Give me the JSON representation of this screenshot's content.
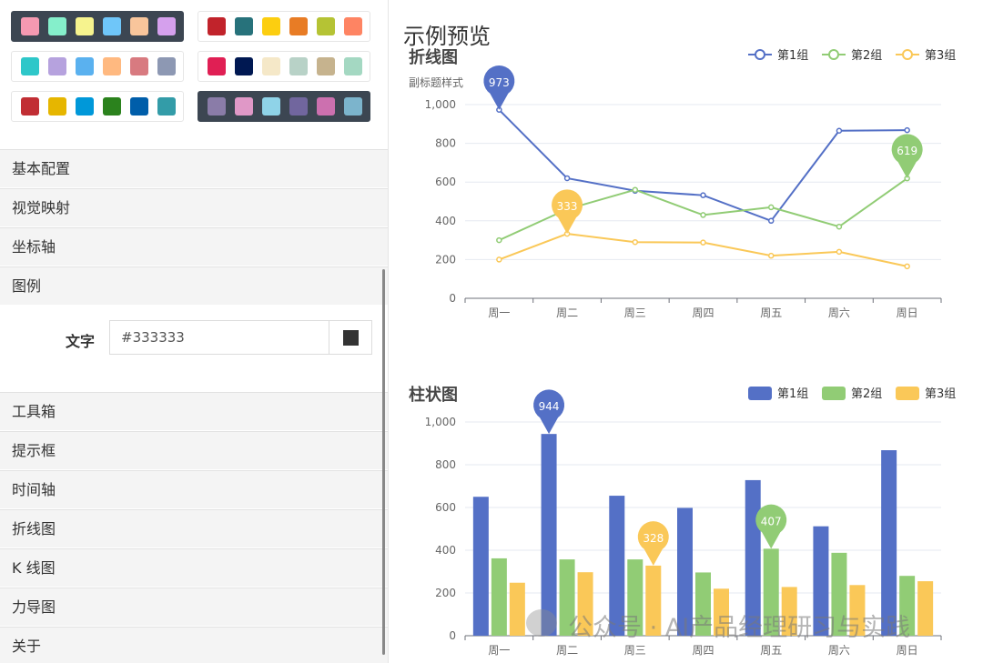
{
  "sidebar": {
    "themes": [
      {
        "colors": [
          "#f599b1",
          "#85efcb",
          "#f6f38e",
          "#6fc6f9",
          "#f8c59b",
          "#d5a0ed"
        ],
        "selected": true
      },
      {
        "colors": [
          "#c1232b",
          "#27727b",
          "#fcce10",
          "#e87c25",
          "#b5c334",
          "#fe8463"
        ],
        "selected": false
      },
      {
        "colors": [
          "#2ec7c9",
          "#b6a2de",
          "#5ab1ef",
          "#ffb980",
          "#d87a80",
          "#8d98b3"
        ],
        "selected": false
      },
      {
        "colors": [
          "#e01f54",
          "#001852",
          "#f5e8c8",
          "#b8d2c7",
          "#c6b38e",
          "#a4d8c2"
        ],
        "selected": false
      },
      {
        "colors": [
          "#c12e34",
          "#e6b600",
          "#0098d9",
          "#2b821d",
          "#005eaa",
          "#339ca8"
        ],
        "selected": false
      },
      {
        "colors": [
          "#8a7ca8",
          "#e098c7",
          "#8fd3e8",
          "#71669e",
          "#cc70af",
          "#7cb4cc"
        ],
        "selected": true
      }
    ],
    "menu": [
      "基本配置",
      "视觉映射",
      "坐标轴",
      "图例",
      "工具箱",
      "提示框",
      "时间轴",
      "折线图",
      "K 线图",
      "力导图",
      "关于"
    ],
    "legend_field": {
      "label": "文字",
      "value": "#333333",
      "swatch_color": "#333333"
    }
  },
  "preview": {
    "title": "示例预览",
    "watermark": "公众号 · AI产品经理研习与实践"
  },
  "colors": {
    "series1": "#5470c6",
    "series2": "#91cc75",
    "series3": "#fac858",
    "selected_theme_bg": "#3c4652"
  },
  "chart_data": [
    {
      "type": "line",
      "title": "折线图",
      "subtitle": "副标题样式",
      "categories": [
        "周一",
        "周二",
        "周三",
        "周四",
        "周五",
        "周六",
        "周日"
      ],
      "series": [
        {
          "name": "第1组",
          "values": [
            973,
            620,
            555,
            532,
            400,
            865,
            868
          ]
        },
        {
          "name": "第2组",
          "values": [
            300,
            460,
            560,
            430,
            470,
            370,
            619
          ]
        },
        {
          "name": "第3组",
          "values": [
            200,
            333,
            290,
            288,
            220,
            240,
            165
          ]
        }
      ],
      "markers": [
        {
          "series": 0,
          "index": 0,
          "label": "973"
        },
        {
          "series": 2,
          "index": 1,
          "label": "333"
        },
        {
          "series": 1,
          "index": 6,
          "label": "619"
        }
      ],
      "ylim": [
        0,
        1000
      ],
      "yticks": [
        "0",
        "200",
        "400",
        "600",
        "800",
        "1,000"
      ],
      "legend": "top-right",
      "grid": true
    },
    {
      "type": "bar",
      "title": "柱状图",
      "categories": [
        "周一",
        "周二",
        "周三",
        "周四",
        "周五",
        "周六",
        "周日"
      ],
      "series": [
        {
          "name": "第1组",
          "values": [
            650,
            944,
            655,
            598,
            728,
            512,
            868
          ]
        },
        {
          "name": "第2组",
          "values": [
            362,
            357,
            357,
            296,
            407,
            388,
            280
          ]
        },
        {
          "name": "第3组",
          "values": [
            248,
            297,
            328,
            220,
            228,
            237,
            255
          ]
        }
      ],
      "markers": [
        {
          "series": 0,
          "index": 1,
          "label": "944"
        },
        {
          "series": 2,
          "index": 2,
          "label": "328"
        },
        {
          "series": 1,
          "index": 4,
          "label": "407"
        }
      ],
      "ylim": [
        0,
        1000
      ],
      "yticks": [
        "0",
        "200",
        "400",
        "600",
        "800",
        "1,000"
      ],
      "legend": "top-right",
      "grid": true
    }
  ]
}
